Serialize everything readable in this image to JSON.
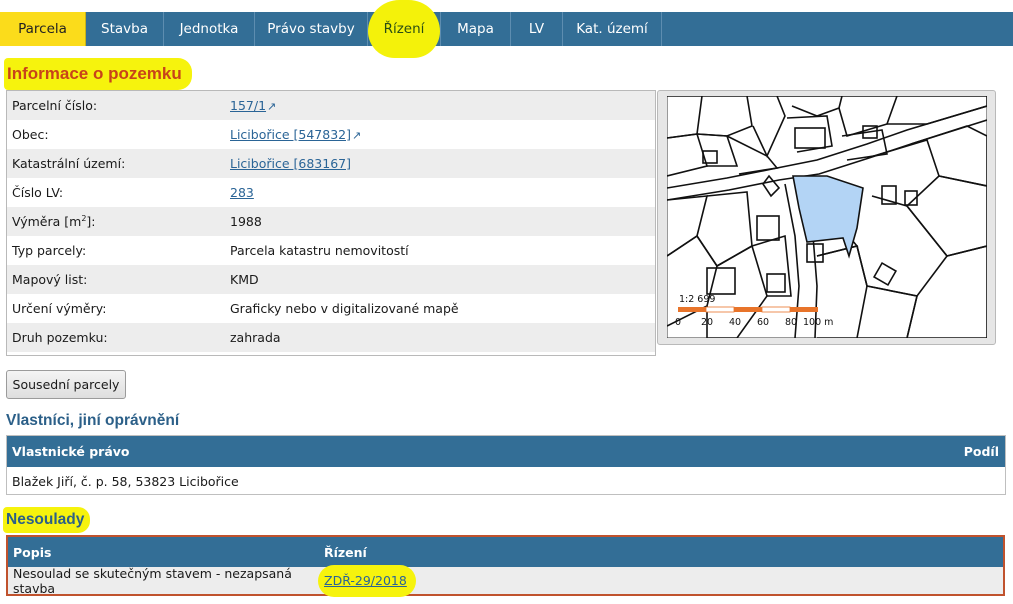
{
  "tabs": [
    {
      "label": "Parcela",
      "width": 86,
      "active": true
    },
    {
      "label": "Stavba",
      "width": 78
    },
    {
      "label": "Jednotka",
      "width": 91
    },
    {
      "label": "Právo stavby",
      "width": 113
    },
    {
      "label": "Řízení",
      "width": 73,
      "highlighted": true
    },
    {
      "label": "Mapa",
      "width": 70
    },
    {
      "label": "LV",
      "width": 52
    },
    {
      "label": "Kat. území",
      "width": 99
    }
  ],
  "heading": "Informace o pozemku",
  "info": [
    {
      "key": "Parcelní číslo:",
      "value": "157/1",
      "link": true,
      "ext": true
    },
    {
      "key": "Obec:",
      "value": "Licibořice [547832]",
      "link": true,
      "ext": true
    },
    {
      "key": "Katastrální území:",
      "value": "Licibořice [683167]",
      "link": true
    },
    {
      "key": "Číslo LV:",
      "value": "283",
      "link": true
    },
    {
      "key": "Výměra [m",
      "sup": "2",
      "key_suffix": "]:",
      "value": "1988"
    },
    {
      "key": "Typ parcely:",
      "value": "Parcela katastru nemovitostí"
    },
    {
      "key": "Mapový list:",
      "value": "KMD"
    },
    {
      "key": "Určení výměry:",
      "value": "Graficky nebo v digitalizované mapě"
    },
    {
      "key": "Druh pozemku:",
      "value": "zahrada"
    }
  ],
  "map": {
    "scale": "1:2 699",
    "ticks": [
      "0",
      "20",
      "40",
      "60",
      "80",
      "100 m"
    ],
    "parcel_color": "#b3d4f5",
    "scale_color": "#e8742a"
  },
  "neighbors_button": "Sousední parcely",
  "owners": {
    "heading": "Vlastníci, jiní oprávnění",
    "col1": "Vlastnické právo",
    "col2": "Podíl",
    "rows": [
      "Blažek Jiří, č. p. 58, 53823 Licibořice"
    ]
  },
  "nesoulady": {
    "heading": "Nesoulady",
    "col1": "Popis",
    "col2": "Řízení",
    "rows": [
      {
        "popis": "Nesoulad se skutečným stavem - nezapsaná stavba",
        "rizeni": "ZDŘ-29/2018"
      }
    ]
  },
  "colors": {
    "header_blue": "#336e96",
    "active_tab": "#fbdc1b",
    "highlight": "#f6f30d",
    "heading_red": "#c8431a",
    "link": "#2a6496",
    "nes_border": "#c0522d"
  }
}
